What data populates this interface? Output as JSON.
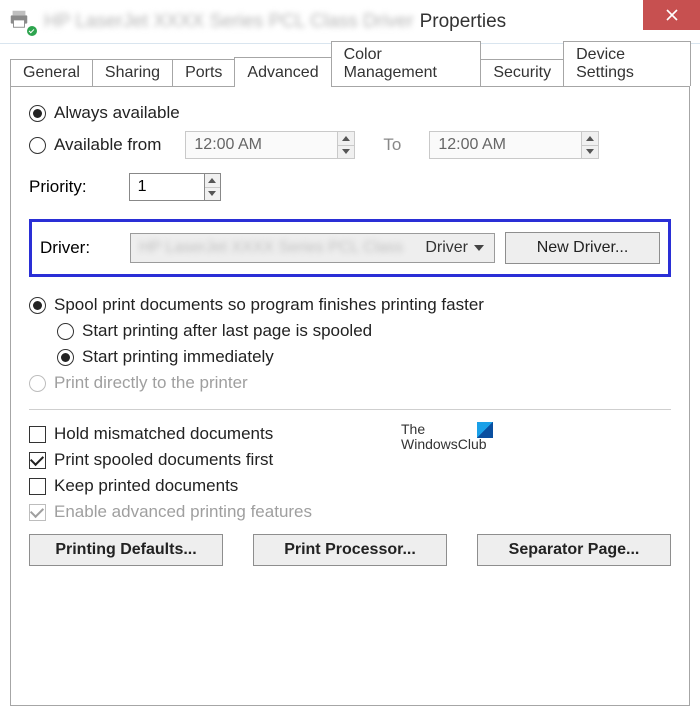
{
  "title": {
    "suffix": "Properties"
  },
  "tabs": [
    "General",
    "Sharing",
    "Ports",
    "Advanced",
    "Color Management",
    "Security",
    "Device Settings"
  ],
  "activeTab": "Advanced",
  "availability": {
    "alwaysLabel": "Always available",
    "fromLabel": "Available from",
    "selected": "always",
    "from": "12:00 AM",
    "toLabel": "To",
    "to": "12:00 AM"
  },
  "priority": {
    "label": "Priority:",
    "value": "1"
  },
  "driver": {
    "label": "Driver:",
    "selectedSuffix": "Driver",
    "newBtn": "New Driver..."
  },
  "spool": {
    "spoolLabel": "Spool print documents so program finishes printing faster",
    "afterLastLabel": "Start printing after last page is spooled",
    "immediateLabel": "Start printing immediately",
    "directLabel": "Print directly to the printer",
    "mode": "spool",
    "start": "immediate"
  },
  "options": {
    "holdLabel": "Hold mismatched documents",
    "hold": false,
    "spooledFirstLabel": "Print spooled documents first",
    "spooledFirst": true,
    "keepLabel": "Keep printed documents",
    "keep": false,
    "advFeaturesLabel": "Enable advanced printing features",
    "advFeatures": true
  },
  "buttons": {
    "defaults": "Printing Defaults...",
    "processor": "Print Processor...",
    "separator": "Separator Page..."
  },
  "watermark": {
    "line1": "The",
    "line2": "WindowsClub"
  }
}
